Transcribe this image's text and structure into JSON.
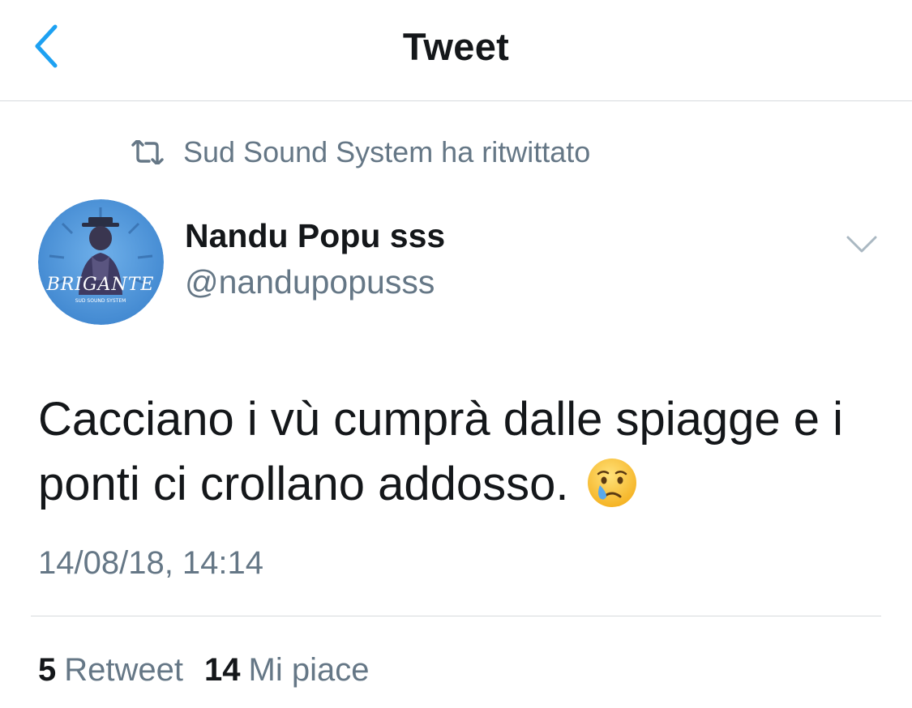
{
  "navbar": {
    "title": "Tweet",
    "back_icon": "chevron-left-icon",
    "accent_color": "#1da1f2"
  },
  "retweet": {
    "icon": "retweet-icon",
    "text": "Sud Sound System ha ritwittato"
  },
  "author": {
    "name": "Nandu Popu sss",
    "handle": "@nandupopusss",
    "avatar_text": "BRIGANTE",
    "avatar_subtext": "SUD SOUND SYSTEM",
    "avatar_bg": "#4a90d9"
  },
  "tweet": {
    "text": "Cacciano i vù cumprà dalle spiagge e i ponti ci crollano addosso.",
    "emoji": "crying-face-emoji",
    "timestamp": "14/08/18, 14:14"
  },
  "stats": {
    "retweets_count": "5",
    "retweets_label": "Retweet",
    "likes_count": "14",
    "likes_label": "Mi piace"
  },
  "colors": {
    "text_primary": "#14171a",
    "text_secondary": "#657786",
    "divider": "#d7dadd"
  }
}
